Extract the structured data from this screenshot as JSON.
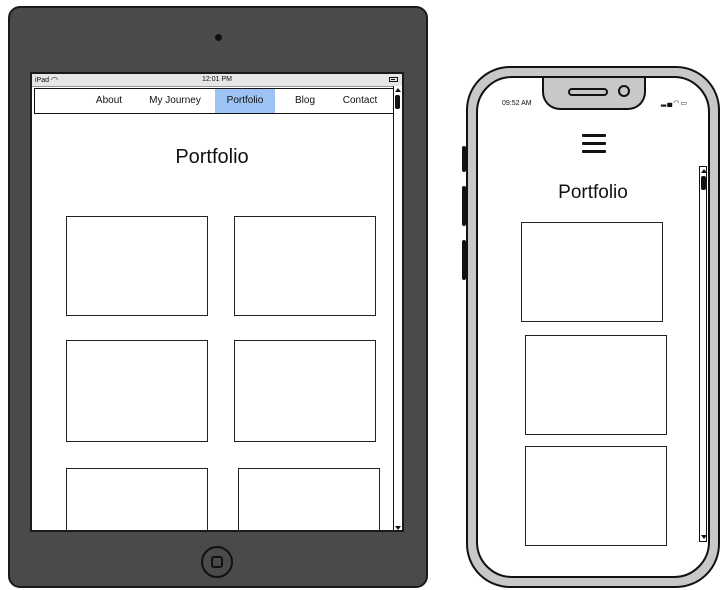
{
  "tablet": {
    "status_bar": {
      "carrier": "iPad",
      "time": "12:01 PM"
    },
    "nav": [
      {
        "label": "About",
        "active": false
      },
      {
        "label": "My Journey",
        "active": false
      },
      {
        "label": "Portfolio",
        "active": true
      },
      {
        "label": "Blog",
        "active": false
      },
      {
        "label": "Contact",
        "active": false
      }
    ],
    "page_title": "Portfolio",
    "accent_color": "#9dc3f5"
  },
  "phone": {
    "status_bar": {
      "time": "09:52 AM"
    },
    "menu_icon": "hamburger-menu-icon",
    "page_title": "Portfolio"
  }
}
